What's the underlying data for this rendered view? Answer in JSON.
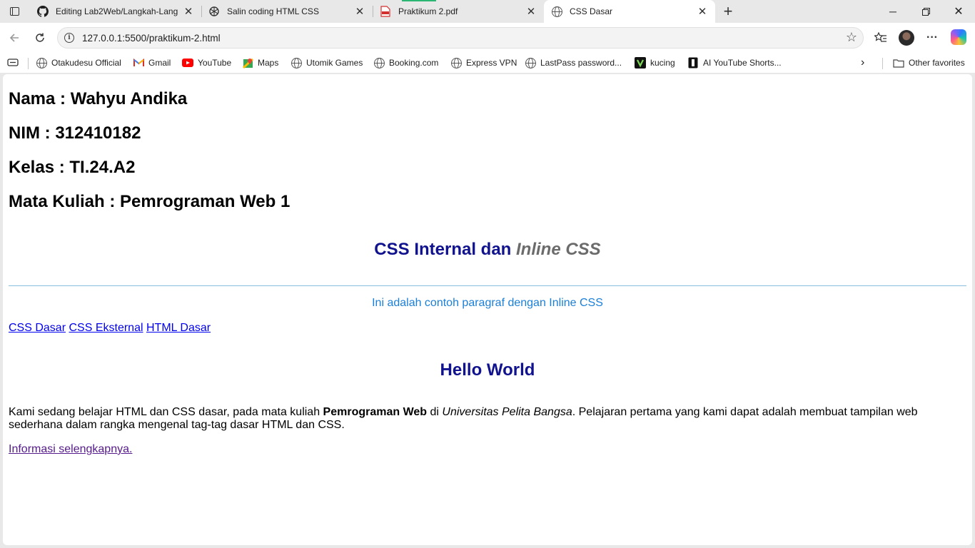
{
  "colors": {
    "heading_blue": "#10128e",
    "inline_gray": "#6b6b6b",
    "paragraph_blue": "#1a7fd8",
    "hr_blue": "#87bfdc",
    "link_blue": "#0000ee",
    "link_visited": "#551a8b"
  },
  "browser": {
    "tabs": [
      {
        "title": "Editing Lab2Web/Langkah-Langkah",
        "icon": "github-icon",
        "active": false
      },
      {
        "title": "Salin coding HTML CSS",
        "icon": "chatgpt-icon",
        "active": false
      },
      {
        "title": "Praktikum 2.pdf",
        "icon": "pdf-icon",
        "active": false
      },
      {
        "title": "CSS Dasar",
        "icon": "globe-icon",
        "active": true
      }
    ],
    "address": {
      "url": "127.0.0.1:5500/praktikum-2.html"
    },
    "bookmarks": [
      {
        "label": "Otakudesu Official",
        "icon": "globe-icon"
      },
      {
        "label": "Gmail",
        "icon": "gmail-icon"
      },
      {
        "label": "YouTube",
        "icon": "youtube-icon"
      },
      {
        "label": "Maps",
        "icon": "maps-icon"
      },
      {
        "label": "Utomik Games",
        "icon": "globe-icon"
      },
      {
        "label": "Booking.com",
        "icon": "globe-icon"
      },
      {
        "label": "Express VPN",
        "icon": "globe-icon"
      },
      {
        "label": "LastPass password...",
        "icon": "globe-icon"
      },
      {
        "label": "kucing",
        "icon": "vim-icon"
      },
      {
        "label": "AI YouTube Shorts...",
        "icon": "bookmark-app-icon"
      }
    ],
    "other_favorites": "Other favorites"
  },
  "page": {
    "nama": "Nama : Wahyu Andika",
    "nim": "NIM : 312410182",
    "kelas": "Kelas : TI.24.A2",
    "matkul": "Mata Kuliah : Pemrograman Web 1",
    "css_heading_main": "CSS Internal dan ",
    "css_heading_inline": "Inline CSS",
    "inline_paragraph": "Ini adalah contoh paragraf dengan Inline CSS",
    "nav_links": [
      "CSS Dasar",
      "CSS Eksternal",
      "HTML Dasar"
    ],
    "hello_heading": "Hello World",
    "body_part1": "Kami sedang belajar HTML dan CSS dasar, pada mata kuliah ",
    "body_bold": "Pemrograman Web",
    "body_part2": " di ",
    "body_italic": "Universitas Pelita Bangsa",
    "body_part3": ". Pelajaran pertama yang kami dapat adalah membuat tampilan web sederhana dalam rangka mengenal tag-tag dasar HTML dan CSS.",
    "more_link": "Informasi selengkapnya."
  }
}
